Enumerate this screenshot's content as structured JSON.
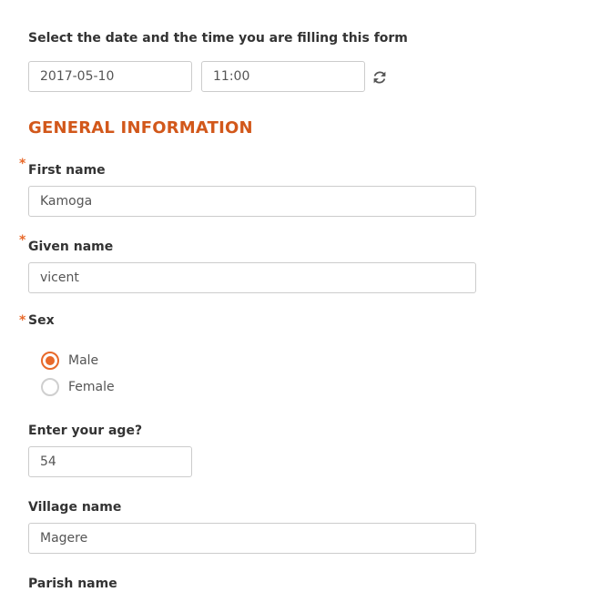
{
  "form": {
    "datetime_label": "Select the date and the time you are filling this form",
    "date_value": "2017-05-10",
    "time_value": "11:00",
    "refresh_icon": "refresh-icon",
    "section_title": "GENERAL INFORMATION",
    "required_marker": "*",
    "first_name": {
      "label": "First name",
      "value": "Kamoga"
    },
    "given_name": {
      "label": "Given name",
      "value": "vicent"
    },
    "sex": {
      "label": "Sex",
      "options": [
        {
          "label": "Male",
          "checked": true
        },
        {
          "label": "Female",
          "checked": false
        }
      ]
    },
    "age": {
      "label": "Enter your age?",
      "value": "54"
    },
    "village": {
      "label": "Village name",
      "value": "Magere"
    },
    "parish": {
      "label": "Parish name"
    }
  },
  "colors": {
    "accent": "#e8692a",
    "section_title": "#d2581b",
    "border": "#cccccc"
  }
}
